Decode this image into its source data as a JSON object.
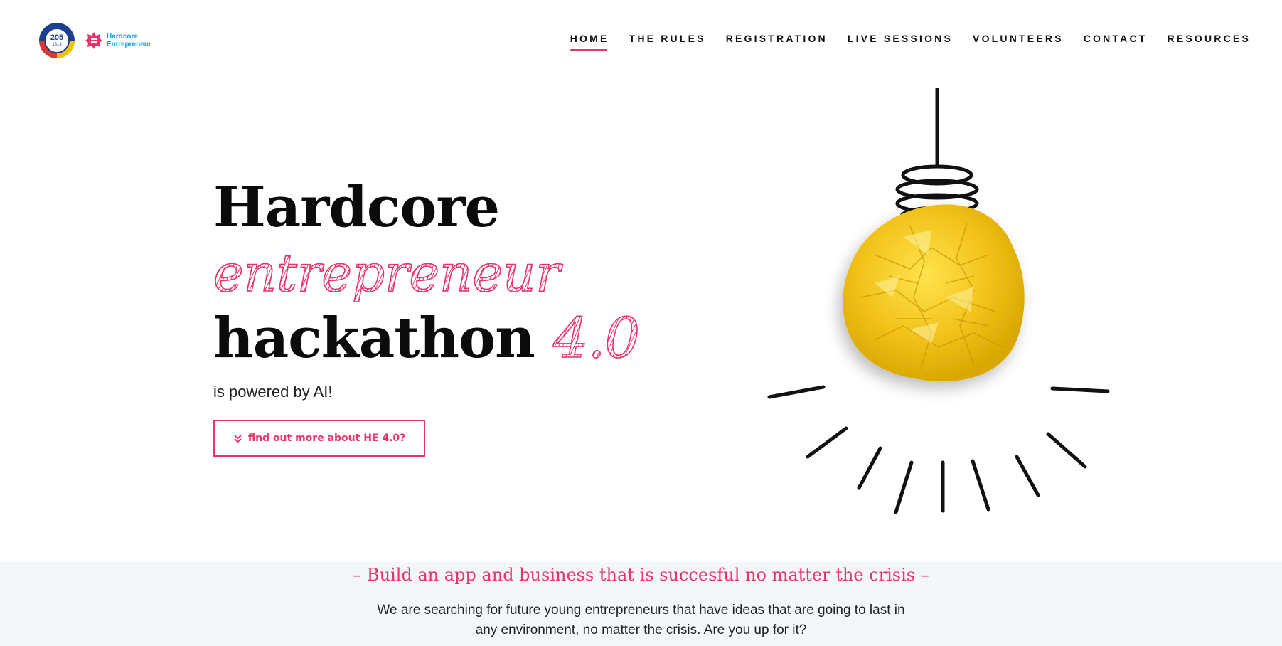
{
  "logos": {
    "seal": {
      "number": "205",
      "year": "1818"
    },
    "brand": {
      "line1": "Hardcore",
      "line2": "Entrepreneur"
    }
  },
  "nav": {
    "items": [
      {
        "label": "HOME",
        "active": true
      },
      {
        "label": "THE RULES",
        "active": false
      },
      {
        "label": "REGISTRATION",
        "active": false
      },
      {
        "label": "LIVE SESSIONS",
        "active": false
      },
      {
        "label": "VOLUNTEERS",
        "active": false
      },
      {
        "label": "CONTACT",
        "active": false
      },
      {
        "label": "RESOURCES",
        "active": false
      }
    ]
  },
  "hero": {
    "title_line1": "Hardcore",
    "title_line2": "entrepreneur",
    "title_line3": "hackathon",
    "title_version": "4.0",
    "subtitle": "is powered by AI!",
    "cta_label": "find out more about HE 4.0?"
  },
  "band": {
    "tagline": "– Build an app and business that is succesful no matter the crisis –",
    "desc_line1": "We are searching for future young entrepreneurs that have ideas that are going to last in",
    "desc_line2": "any environment, no matter the crisis. Are you up for it?"
  },
  "colors": {
    "accent": "#e8336b",
    "bulb_yellow": "#f2c21a",
    "band_bg": "#f4f7f9"
  }
}
